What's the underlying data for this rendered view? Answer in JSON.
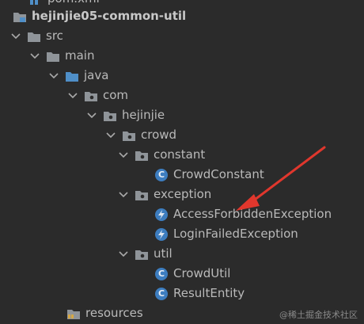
{
  "tree": {
    "partial_top": "pom.xml",
    "module": "hejinjie05-common-util",
    "src": "src",
    "main": "main",
    "java": "java",
    "com": "com",
    "hejinjie": "hejinjie",
    "crowd": "crowd",
    "constant": "constant",
    "crowd_constant": "CrowdConstant",
    "exception": "exception",
    "access_forbidden": "AccessForbiddenException",
    "login_failed": "LoginFailedException",
    "util": "util",
    "crowd_util": "CrowdUtil",
    "result_entity": "ResultEntity",
    "resources": "resources"
  },
  "class_icon_letter": "C",
  "watermark": "@稀土掘金技术社区",
  "colors": {
    "background": "#2b2b2b",
    "text": "#bababa",
    "folder_gray": "#8f9499",
    "folder_blue": "#4f8fc8",
    "class_icon": "#3d7dbf",
    "annotation_arrow": "#e0372d"
  }
}
